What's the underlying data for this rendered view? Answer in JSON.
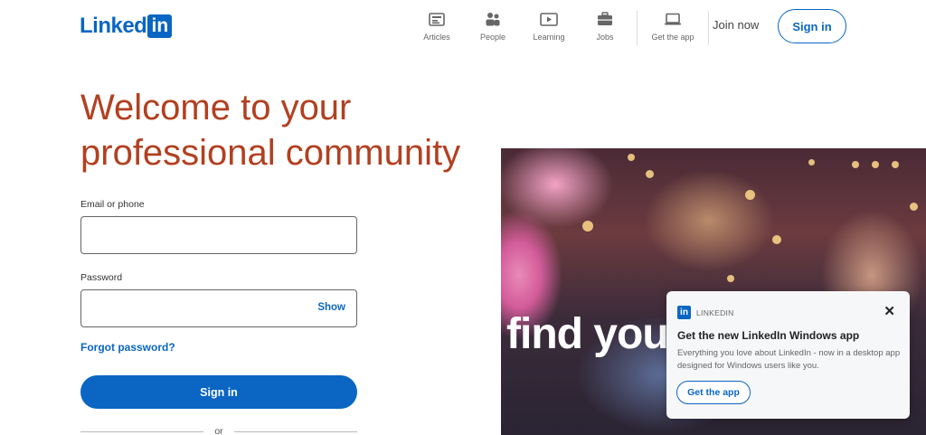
{
  "header": {
    "logo_text": "Linked",
    "logo_box_text": "in",
    "nav": [
      {
        "label": "Articles",
        "icon": "articles-icon"
      },
      {
        "label": "People",
        "icon": "people-icon"
      },
      {
        "label": "Learning",
        "icon": "learning-icon"
      },
      {
        "label": "Jobs",
        "icon": "jobs-icon"
      },
      {
        "label": "Get the app",
        "icon": "laptop-icon"
      }
    ],
    "join_label": "Join now",
    "signin_label": "Sign in"
  },
  "hero": {
    "headline_line1": "Welcome to your",
    "headline_line2": "professional community"
  },
  "form": {
    "email_label": "Email or phone",
    "email_value": "",
    "password_label": "Password",
    "password_value": "",
    "show_label": "Show",
    "forgot_label": "Forgot password?",
    "signin_label": "Sign in",
    "or_label": "or"
  },
  "photo": {
    "overlay_text": "find you"
  },
  "toast": {
    "brand_box": "in",
    "brand": "LINKEDIN",
    "title": "Get the new LinkedIn Windows app",
    "description": "Everything you love about LinkedIn - now in a desktop app designed for Windows users like you.",
    "button_label": "Get the app",
    "close_glyph": "✕"
  },
  "colors": {
    "brand_blue": "#0a66c2",
    "headline": "#b24020"
  }
}
